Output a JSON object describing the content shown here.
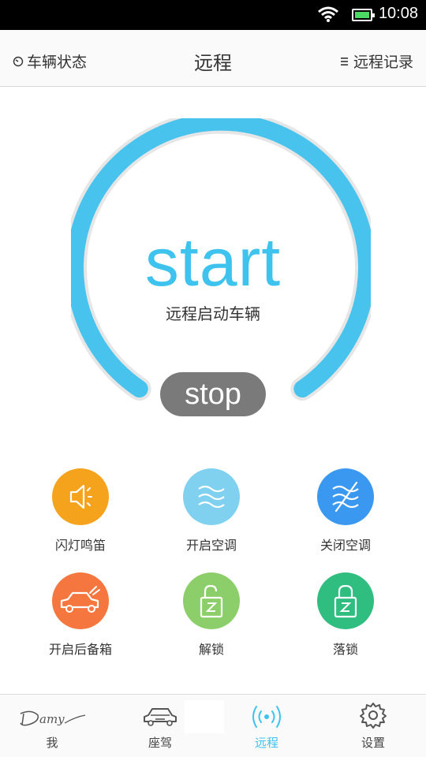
{
  "status_bar": {
    "time": "10:08"
  },
  "nav": {
    "left_label": "车辆状态",
    "title": "远程",
    "right_label": "远程记录"
  },
  "dial": {
    "start_label": "start",
    "subtitle": "远程启动车辆",
    "stop_label": "stop",
    "accent": "#3ec3ee"
  },
  "functions": [
    {
      "label": "闪灯鸣笛",
      "icon": "horn-icon",
      "color": "#f5a31d"
    },
    {
      "label": "开启空调",
      "icon": "ac-on-icon",
      "color": "#7fd1ef"
    },
    {
      "label": "关闭空调",
      "icon": "ac-off-icon",
      "color": "#3a98f0"
    },
    {
      "label": "开启后备箱",
      "icon": "trunk-icon",
      "color": "#f5773f"
    },
    {
      "label": "解锁",
      "icon": "unlock-icon",
      "color": "#8ccf6a"
    },
    {
      "label": "落锁",
      "icon": "lock-icon",
      "color": "#2fbd80"
    }
  ],
  "tabs": [
    {
      "label": "我",
      "icon": "damy-logo"
    },
    {
      "label": "座驾",
      "icon": "car-icon"
    },
    {
      "label": "远程",
      "icon": "remote-signal-icon",
      "active": true
    },
    {
      "label": "设置",
      "icon": "gear-icon"
    }
  ]
}
